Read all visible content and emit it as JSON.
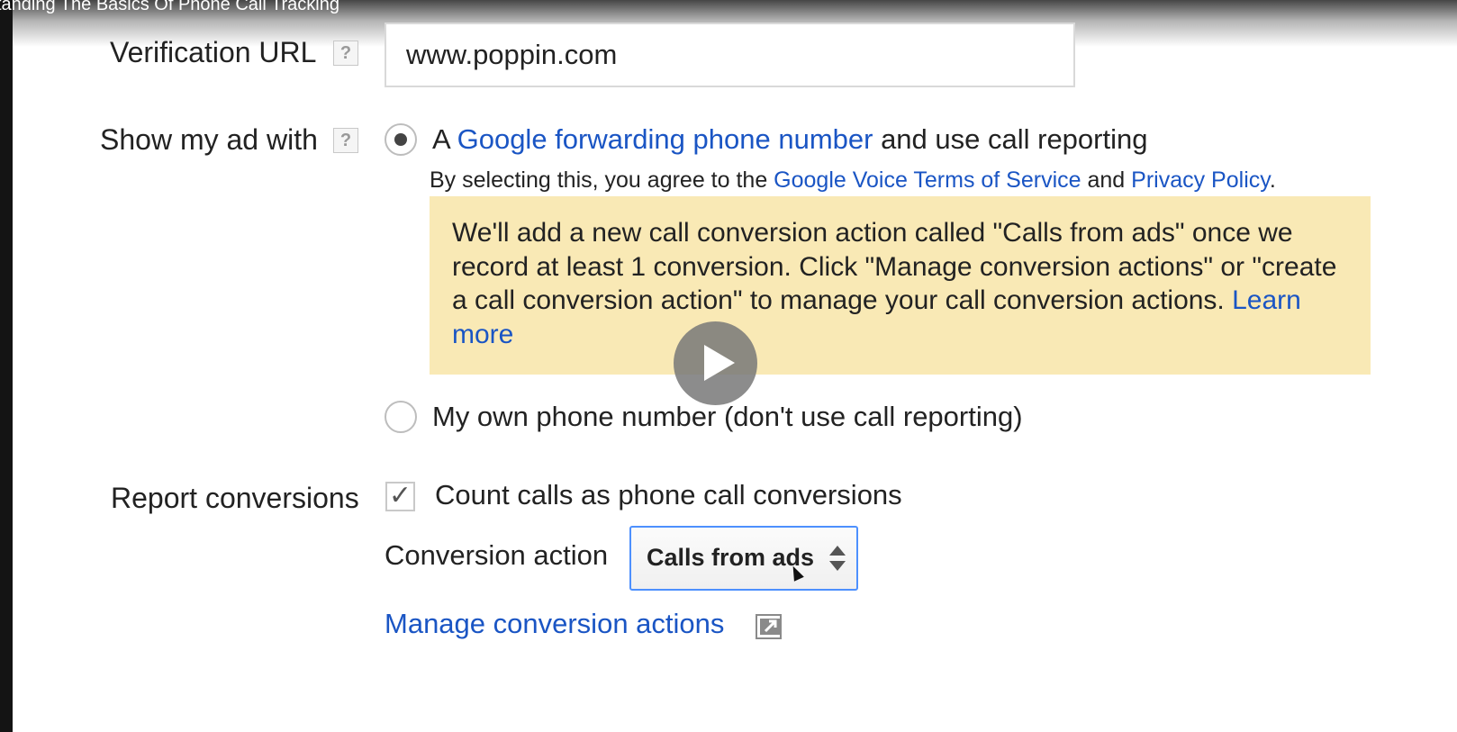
{
  "video": {
    "title": "standing The Basics Of Phone Call Tracking",
    "play_icon": "play-icon"
  },
  "verification_url": {
    "label": "Verification URL",
    "help": "?",
    "value": "www.poppin.com"
  },
  "show_ad_with": {
    "label": "Show my ad with",
    "help": "?",
    "option_forwarding": {
      "selected": true,
      "prefix": "A ",
      "link": "Google forwarding phone number",
      "suffix": " and use call reporting"
    },
    "agreement": {
      "prefix": "By selecting this, you agree to the ",
      "terms_link": "Google Voice Terms of Service",
      "middle": " and ",
      "privacy_link": "Privacy Policy",
      "suffix": "."
    },
    "notice": {
      "text": "We'll add a new call conversion action called \"Calls from ads\" once we record at least 1 conversion. Click \"Manage conversion actions\" or \"create a call conversion action\" to manage your call conversion actions. ",
      "link": "Learn more",
      "background": "#f9e9b5"
    },
    "option_own": {
      "selected": false,
      "label": "My own phone number (don't use call reporting)"
    }
  },
  "report_conversions": {
    "label": "Report conversions",
    "checkbox_checked": true,
    "checkbox_label": "Count calls as phone call conversions",
    "conversion_action_label": "Conversion action",
    "conversion_action_value": "Calls from ads",
    "manage_link": "Manage conversion actions",
    "external_icon": "external-link-icon"
  },
  "colors": {
    "link": "#1a55c4",
    "select_border": "#4d90fe"
  }
}
